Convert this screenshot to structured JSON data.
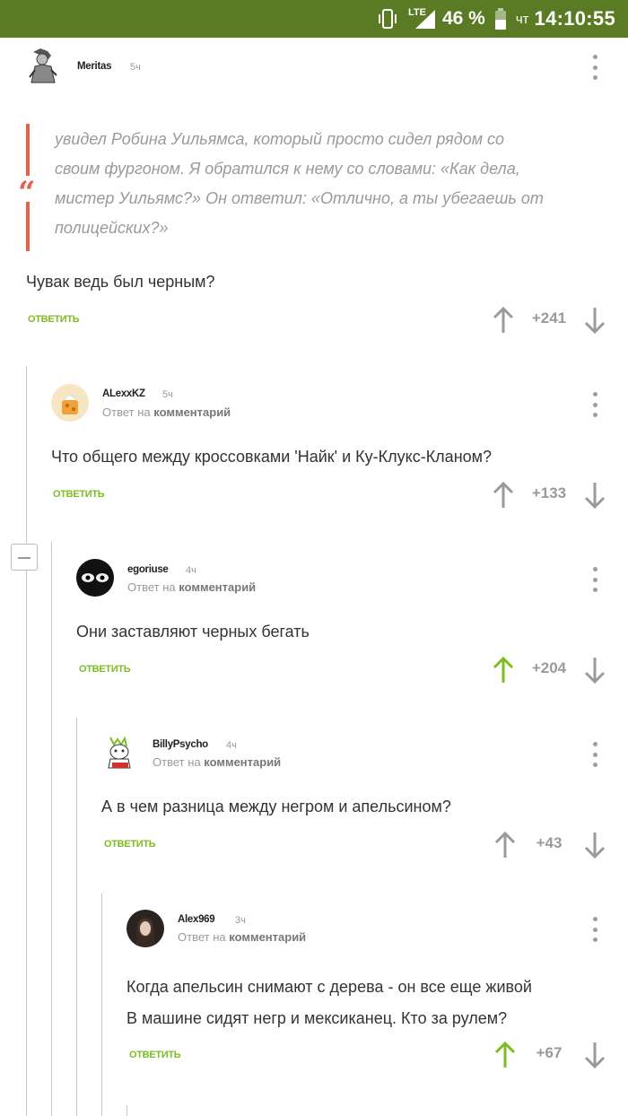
{
  "status_bar": {
    "network": "LTE",
    "battery_percent": "46 %",
    "day": "чт",
    "time": "14:10:55"
  },
  "colors": {
    "status_bar_bg": "#5a7a24",
    "accent_green": "#7cbd22",
    "quote_accent": "#e8604a",
    "vote_grey": "#9a9a9a"
  },
  "comments": [
    {
      "author": "Meritas",
      "time": "5ч",
      "quote": [
        "увидел Робина Уильямса, который просто сидел рядом со",
        "своим фургоном. Я обратился к нему со словами: «Как дела,",
        "мистер Уильямс?» Он ответил: «Отлично, а ты убегаешь от",
        "полицейских?»"
      ],
      "text": [
        "Чувак ведь был черным?"
      ],
      "reply_label": "ОТВЕТИТЬ",
      "rating": "+241",
      "upvoted": false
    },
    {
      "author": "ALexxKZ",
      "time": "5ч",
      "reply_prefix": "Ответ на",
      "reply_target": "комментарий",
      "text": [
        "Что общего между кроссовками 'Найк' и Ку-Клукс-Кланом?"
      ],
      "reply_label": "ОТВЕТИТЬ",
      "rating": "+133",
      "upvoted": false
    },
    {
      "author": "egoriuse",
      "time": "4ч",
      "reply_prefix": "Ответ на",
      "reply_target": "комментарий",
      "text": [
        "Они заставляют черных бегать"
      ],
      "reply_label": "ОТВЕТИТЬ",
      "rating": "+204",
      "upvoted": true
    },
    {
      "author": "BillyPsycho",
      "time": "4ч",
      "reply_prefix": "Ответ на",
      "reply_target": "комментарий",
      "text": [
        "А в чем разница между негром и апельсином?"
      ],
      "reply_label": "ОТВЕТИТЬ",
      "rating": "+43",
      "upvoted": false
    },
    {
      "author": "Alex969",
      "time": "3ч",
      "reply_prefix": "Ответ на",
      "reply_target": "комментарий",
      "text": [
        "Когда апельсин снимают с дерева - он все еще живой",
        "В машине сидят негр и мексиканец. Кто за рулем?"
      ],
      "reply_label": "ОТВЕТИТЬ",
      "rating": "+67",
      "upvoted": true
    }
  ]
}
